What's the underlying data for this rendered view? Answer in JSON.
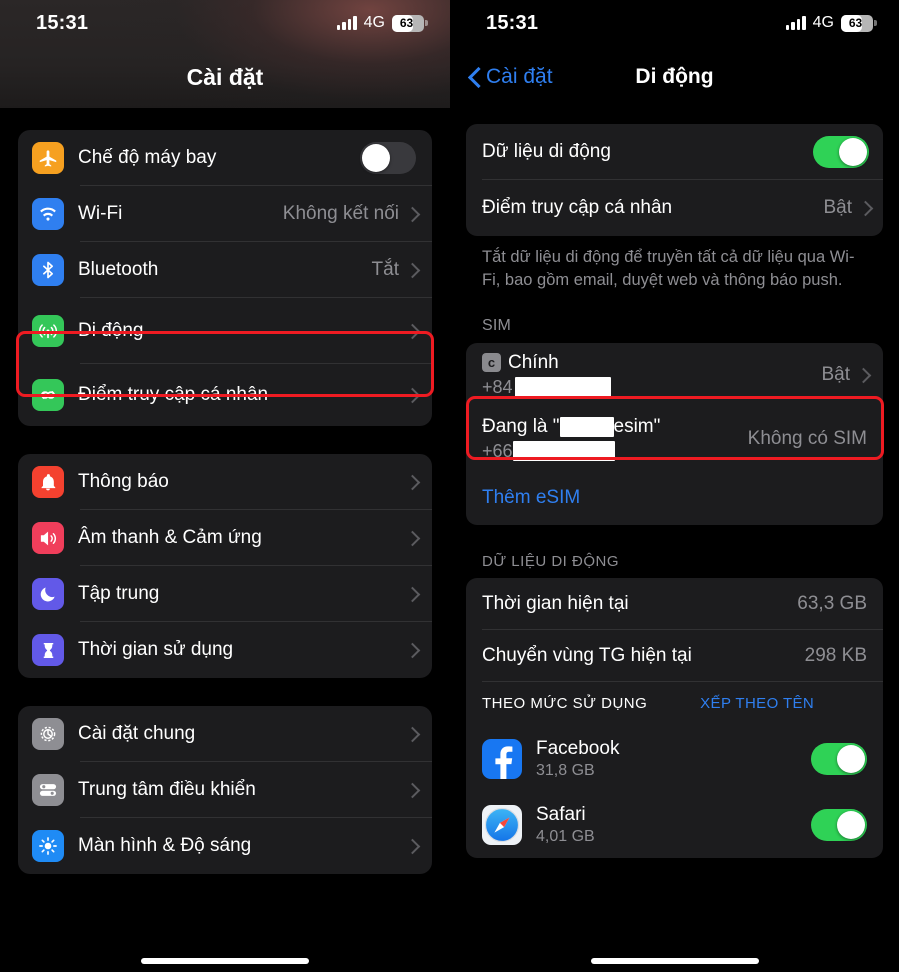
{
  "left": {
    "status": {
      "time": "15:31",
      "network": "4G",
      "battery": "63"
    },
    "nav": {
      "title": "Cài đặt"
    },
    "group1": [
      {
        "label": "Chế độ máy bay",
        "icon": "airplane-icon",
        "control": "toggle",
        "toggle": "off"
      },
      {
        "label": "Wi-Fi",
        "icon": "wifi-icon",
        "control": "value",
        "value": "Không kết nối"
      },
      {
        "label": "Bluetooth",
        "icon": "bluetooth-icon",
        "control": "value",
        "value": "Tắt"
      },
      {
        "label": "Di động",
        "icon": "cellular-icon",
        "control": "chevron",
        "value": "",
        "highlighted": true
      },
      {
        "label": "Điểm truy cập cá nhân",
        "icon": "hotspot-icon",
        "control": "chevron",
        "value": ""
      }
    ],
    "group2": [
      {
        "label": "Thông báo",
        "icon": "bell-icon"
      },
      {
        "label": "Âm thanh & Cảm ứng",
        "icon": "speaker-icon"
      },
      {
        "label": "Tập trung",
        "icon": "moon-icon"
      },
      {
        "label": "Thời gian sử dụng",
        "icon": "hourglass-icon"
      }
    ],
    "group3": [
      {
        "label": "Cài đặt chung",
        "icon": "gear-icon"
      },
      {
        "label": "Trung tâm điều khiển",
        "icon": "control-center-icon"
      },
      {
        "label": "Màn hình & Độ sáng",
        "icon": "brightness-icon"
      }
    ]
  },
  "right": {
    "status": {
      "time": "15:31",
      "network": "4G",
      "battery": "63"
    },
    "nav": {
      "back_label": "Cài đặt",
      "title": "Di động"
    },
    "data_card": [
      {
        "label": "Dữ liệu di động",
        "control": "toggle",
        "toggle": "on"
      },
      {
        "label": "Điểm truy cập cá nhân",
        "control": "value",
        "value": "Bật"
      }
    ],
    "data_footnote": "Tắt dữ liệu di động để truyền tất cả dữ liệu qua Wi-Fi, bao gồm email, duyệt web và thông báo push.",
    "sim": {
      "header": "SIM",
      "rows": [
        {
          "badge": "c",
          "name": "Chính",
          "prefix": "+84",
          "redacted_width": 96,
          "value": "Bật",
          "chevron": true,
          "highlighted": true
        },
        {
          "name_prefix": "Đang là \"",
          "name_redacted_width": 54,
          "name_suffix": " esim\"",
          "prefix": "+66",
          "redacted_width": 102,
          "value": "Không có SIM",
          "chevron": false
        }
      ],
      "add_esim": "Thêm eSIM"
    },
    "usage": {
      "header": "DỮ LIỆU DI ĐỘNG",
      "rows": [
        {
          "label": "Thời gian hiện tại",
          "value": "63,3 GB"
        },
        {
          "label": "Chuyển vùng TG hiện tại",
          "value": "298 KB"
        }
      ],
      "sort_label": "THEO MỨC SỬ DỤNG",
      "sort_action": "XẾP THEO TÊN",
      "apps": [
        {
          "name": "Facebook",
          "size": "31,8 GB",
          "icon": "facebook-icon",
          "toggle": "on"
        },
        {
          "name": "Safari",
          "size": "4,01 GB",
          "icon": "safari-icon",
          "toggle": "on"
        }
      ]
    }
  },
  "colors": {
    "accent_blue": "#2f7ff0",
    "toggle_on": "#2fd256",
    "highlight_red": "#ee1b22",
    "card_bg": "#1c1c1e",
    "secondary_text": "#8e8e93"
  }
}
